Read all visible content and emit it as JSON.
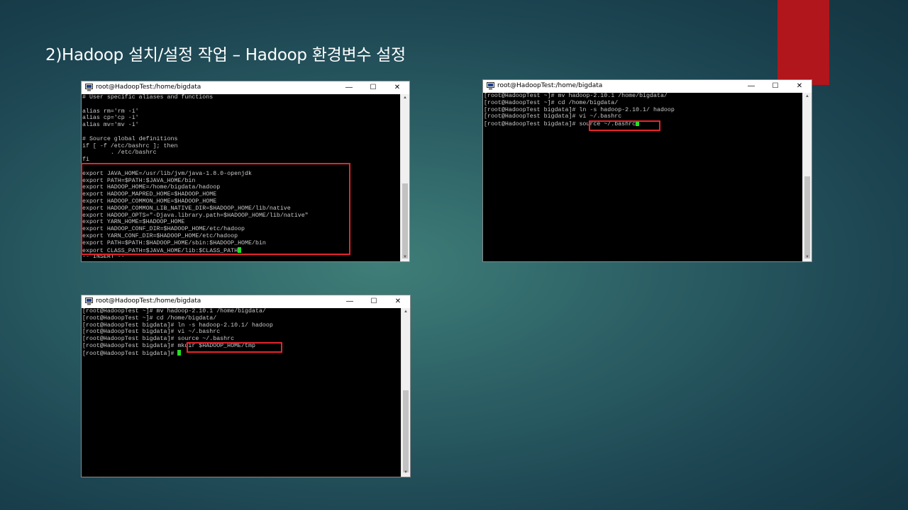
{
  "slide": {
    "title": "2)Hadoop 설치/설정 작업 – Hadoop 환경변수 설정",
    "accent_color": "#b0161c"
  },
  "windows": {
    "vi_bashrc": {
      "title": "root@HadoopTest:/home/bigdata",
      "lines": [
        "# User specific aliases and functions",
        "",
        "alias rm='rm -i'",
        "alias cp='cp -i'",
        "alias mv='mv -i'",
        "",
        "# Source global definitions",
        "if [ -f /etc/bashrc ]; then",
        "        . /etc/bashrc",
        "fi",
        "",
        "export JAVA_HOME=/usr/lib/jvm/java-1.8.0-openjdk",
        "export PATH=$PATH:$JAVA_HOME/bin",
        "export HADOOP_HOME=/home/bigdata/hadoop",
        "export HADOOP_MAPRED_HOME=$HADOOP_HOME",
        "export HADOOP_COMMON_HOME=$HADOOP_HOME",
        "export HADOOP_COMMON_LIB_NATIVE_DIR=$HADOOP_HOME/lib/native",
        "export HADOOP_OPTS=\"-Djava.library.path=$HADOOP_HOME/lib/native\"",
        "export YARN_HOME=$HADOOP_HOME",
        "export HADOOP_CONF_DIR=$HADOOP_HOME/etc/hadoop",
        "export YARN_CONF_DIR=$HADOOP_HOME/etc/hadoop",
        "export PATH=$PATH:$HADOOP_HOME/sbin:$HADOOP_HOME/bin",
        "export CLASS_PATH=$JAVA_HOME/lib:$CLASS_PATH"
      ],
      "status_line": "-- INSERT --"
    },
    "source_bashrc": {
      "title": "root@HadoopTest:/home/bigdata",
      "lines": [
        "[root@HadoopTest ~]# mv hadoop-2.10.1 /home/bigdata/",
        "[root@HadoopTest ~]# cd /home/bigdata/",
        "[root@HadoopTest bigdata]# ln -s hadoop-2.10.1/ hadoop",
        "[root@HadoopTest bigdata]# vi ~/.bashrc"
      ],
      "prompt": "[root@HadoopTest bigdata]# ",
      "command": "source ~/.bashrc"
    },
    "mkdir_tmp": {
      "title": "root@HadoopTest:/home/bigdata",
      "lines": [
        "[root@HadoopTest ~]# mv hadoop-2.10.1 /home/bigdata/",
        "[root@HadoopTest ~]# cd /home/bigdata/",
        "[root@HadoopTest bigdata]# ln -s hadoop-2.10.1/ hadoop",
        "[root@HadoopTest bigdata]# vi ~/.bashrc",
        "[root@HadoopTest bigdata]# source ~/.bashrc"
      ],
      "prompt": "[root@HadoopTest bigdata]# ",
      "command": "mkdir $HADOOP_HOME/tmp",
      "last_prompt": "[root@HadoopTest bigdata]# "
    }
  },
  "controls": {
    "minimize": "—",
    "maximize": "☐",
    "close": "✕",
    "scroll_up": "▲",
    "scroll_down": "▼"
  },
  "icons": {
    "window_icon": "putty-icon",
    "minimize": "minimize-icon",
    "maximize": "maximize-icon",
    "close": "close-icon"
  },
  "colors": {
    "terminal_bg": "#000000",
    "terminal_text": "#c9c9c9",
    "cursor": "#22e022",
    "highlight_box": "#e8242b"
  }
}
